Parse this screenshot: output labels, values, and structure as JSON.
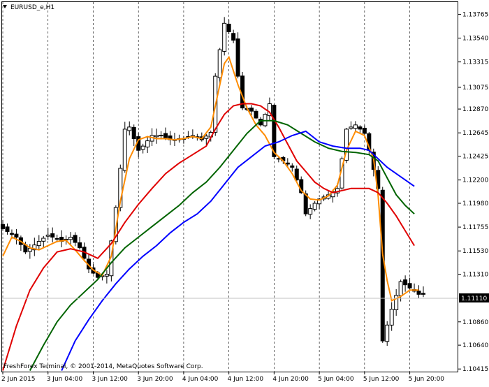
{
  "symbol_label": "EURUSD_e,H1",
  "copyright": "FreshForex Terminal, © 2001-2014, MetaQuotes Software Corp.",
  "current_price": "1.11110",
  "colors": {
    "background": "#ffffff",
    "grid": "#000000",
    "candle": "#000000",
    "ma_orange": "#ff8c00",
    "ma_red": "#e00000",
    "ma_green": "#006400",
    "ma_blue": "#0000ff",
    "price_marker_bg": "#000000",
    "price_marker_fg": "#ffffff"
  },
  "chart_data": {
    "type": "candlestick",
    "yaxis_ticks": [
      "1.13765",
      "1.13540",
      "1.13315",
      "1.13075",
      "1.12870",
      "1.12645",
      "1.12425",
      "1.12200",
      "1.11980",
      "1.11755",
      "1.11530",
      "1.11310",
      "1.10860",
      "1.10640",
      "1.10415"
    ],
    "ytick_values": [
      1.13765,
      1.1354,
      1.13315,
      1.13075,
      1.1287,
      1.12645,
      1.12425,
      1.122,
      1.1198,
      1.11755,
      1.1153,
      1.1131,
      1.1086,
      1.1064,
      1.10415
    ],
    "yrange": [
      1.1039,
      1.1388
    ],
    "xaxis_ticks": [
      "2 Jun 2015",
      "3 Jun 04:00",
      "3 Jun 12:00",
      "3 Jun 20:00",
      "4 Jun 04:00",
      "4 Jun 12:00",
      "4 Jun 20:00",
      "5 Jun 04:00",
      "5 Jun 12:00",
      "5 Jun 20:00"
    ],
    "xtick_index": [
      0,
      10,
      20,
      30,
      40,
      50,
      60,
      70,
      80,
      90
    ],
    "bar_count": 94,
    "current_price_value": 1.1111,
    "close_path": [
      [
        0,
        1.1174
      ],
      [
        3,
        1.1166
      ],
      [
        5,
        1.1152
      ],
      [
        8,
        1.1162
      ],
      [
        10,
        1.1168
      ],
      [
        13,
        1.1162
      ],
      [
        15,
        1.1166
      ],
      [
        17,
        1.1156
      ],
      [
        19,
        1.1136
      ],
      [
        21,
        1.1128
      ],
      [
        23,
        1.1131
      ],
      [
        25,
        1.1194
      ],
      [
        27,
        1.1268
      ],
      [
        28,
        1.127
      ],
      [
        30,
        1.1248
      ],
      [
        31,
        1.1252
      ],
      [
        33,
        1.1262
      ],
      [
        35,
        1.1262
      ],
      [
        37,
        1.1258
      ],
      [
        39,
        1.1258
      ],
      [
        42,
        1.1262
      ],
      [
        44,
        1.1258
      ],
      [
        46,
        1.1265
      ],
      [
        47,
        1.1318
      ],
      [
        49,
        1.1368
      ],
      [
        51,
        1.1352
      ],
      [
        52,
        1.1318
      ],
      [
        53,
        1.1288
      ],
      [
        55,
        1.1285
      ],
      [
        57,
        1.1272
      ],
      [
        59,
        1.1292
      ],
      [
        60,
        1.1242
      ],
      [
        62,
        1.1238
      ],
      [
        64,
        1.1232
      ],
      [
        66,
        1.1208
      ],
      [
        67,
        1.1188
      ],
      [
        69,
        1.1198
      ],
      [
        70,
        1.1202
      ],
      [
        72,
        1.1206
      ],
      [
        74,
        1.1212
      ],
      [
        76,
        1.1268
      ],
      [
        78,
        1.1272
      ],
      [
        80,
        1.1264
      ],
      [
        81,
        1.1248
      ],
      [
        83,
        1.1212
      ],
      [
        84,
        1.1068
      ],
      [
        86,
        1.1098
      ],
      [
        88,
        1.1124
      ],
      [
        90,
        1.1118
      ],
      [
        92,
        1.1112
      ]
    ],
    "series": [
      {
        "color": "#ff8c00",
        "points": [
          [
            0,
            1.1148
          ],
          [
            2,
            1.1166
          ],
          [
            4,
            1.1162
          ],
          [
            6,
            1.1156
          ],
          [
            8,
            1.1154
          ],
          [
            10,
            1.1158
          ],
          [
            12,
            1.1162
          ],
          [
            14,
            1.1163
          ],
          [
            16,
            1.1154
          ],
          [
            18,
            1.1144
          ],
          [
            20,
            1.1135
          ],
          [
            22,
            1.113
          ],
          [
            24,
            1.1148
          ],
          [
            26,
            1.12
          ],
          [
            28,
            1.124
          ],
          [
            30,
            1.1258
          ],
          [
            32,
            1.1261
          ],
          [
            34,
            1.1259
          ],
          [
            36,
            1.1259
          ],
          [
            38,
            1.1258
          ],
          [
            40,
            1.1259
          ],
          [
            42,
            1.1261
          ],
          [
            44,
            1.1259
          ],
          [
            46,
            1.127
          ],
          [
            48,
            1.131
          ],
          [
            49,
            1.133
          ],
          [
            50,
            1.1336
          ],
          [
            52,
            1.131
          ],
          [
            54,
            1.1288
          ],
          [
            56,
            1.1272
          ],
          [
            58,
            1.1262
          ],
          [
            60,
            1.1246
          ],
          [
            62,
            1.1238
          ],
          [
            64,
            1.1226
          ],
          [
            66,
            1.121
          ],
          [
            68,
            1.1202
          ],
          [
            70,
            1.1201
          ],
          [
            72,
            1.1205
          ],
          [
            74,
            1.1215
          ],
          [
            76,
            1.1248
          ],
          [
            78,
            1.1266
          ],
          [
            80,
            1.1262
          ],
          [
            82,
            1.124
          ],
          [
            83,
            1.1205
          ],
          [
            84,
            1.115
          ],
          [
            85,
            1.1125
          ],
          [
            86,
            1.1106
          ],
          [
            88,
            1.111
          ],
          [
            90,
            1.1116
          ],
          [
            92,
            1.1116
          ]
        ]
      },
      {
        "color": "#e00000",
        "points": [
          [
            0,
            1.104
          ],
          [
            3,
            1.1082
          ],
          [
            6,
            1.1116
          ],
          [
            9,
            1.1137
          ],
          [
            12,
            1.1152
          ],
          [
            15,
            1.1155
          ],
          [
            18,
            1.1152
          ],
          [
            21,
            1.1146
          ],
          [
            24,
            1.116
          ],
          [
            27,
            1.118
          ],
          [
            30,
            1.1197
          ],
          [
            33,
            1.1212
          ],
          [
            36,
            1.1226
          ],
          [
            39,
            1.1236
          ],
          [
            42,
            1.1244
          ],
          [
            45,
            1.1252
          ],
          [
            47,
            1.1268
          ],
          [
            49,
            1.1282
          ],
          [
            51,
            1.129
          ],
          [
            53,
            1.1292
          ],
          [
            55,
            1.1292
          ],
          [
            57,
            1.129
          ],
          [
            59,
            1.1284
          ],
          [
            61,
            1.127
          ],
          [
            63,
            1.1254
          ],
          [
            65,
            1.1238
          ],
          [
            67,
            1.1228
          ],
          [
            69,
            1.1218
          ],
          [
            71,
            1.1212
          ],
          [
            73,
            1.1208
          ],
          [
            75,
            1.121
          ],
          [
            77,
            1.1212
          ],
          [
            79,
            1.1212
          ],
          [
            81,
            1.1212
          ],
          [
            83,
            1.1208
          ],
          [
            85,
            1.1198
          ],
          [
            87,
            1.1186
          ],
          [
            89,
            1.1172
          ],
          [
            91,
            1.1158
          ]
        ]
      },
      {
        "color": "#006400",
        "points": [
          [
            6,
            1.104
          ],
          [
            9,
            1.1064
          ],
          [
            12,
            1.1086
          ],
          [
            15,
            1.1102
          ],
          [
            18,
            1.1114
          ],
          [
            21,
            1.1126
          ],
          [
            24,
            1.1142
          ],
          [
            27,
            1.1156
          ],
          [
            30,
            1.1166
          ],
          [
            33,
            1.1176
          ],
          [
            36,
            1.1186
          ],
          [
            39,
            1.1196
          ],
          [
            42,
            1.1208
          ],
          [
            45,
            1.1218
          ],
          [
            48,
            1.1232
          ],
          [
            51,
            1.1248
          ],
          [
            54,
            1.1264
          ],
          [
            57,
            1.1276
          ],
          [
            60,
            1.1276
          ],
          [
            63,
            1.1272
          ],
          [
            66,
            1.1264
          ],
          [
            69,
            1.1256
          ],
          [
            72,
            1.125
          ],
          [
            75,
            1.1247
          ],
          [
            78,
            1.1246
          ],
          [
            81,
            1.1244
          ],
          [
            83,
            1.1238
          ],
          [
            85,
            1.1222
          ],
          [
            87,
            1.1206
          ],
          [
            89,
            1.1196
          ],
          [
            91,
            1.1188
          ]
        ]
      },
      {
        "color": "#0000ff",
        "points": [
          [
            13,
            1.104
          ],
          [
            16,
            1.1068
          ],
          [
            19,
            1.1088
          ],
          [
            22,
            1.1106
          ],
          [
            25,
            1.1122
          ],
          [
            28,
            1.1136
          ],
          [
            31,
            1.1148
          ],
          [
            34,
            1.1158
          ],
          [
            37,
            1.117
          ],
          [
            40,
            1.118
          ],
          [
            43,
            1.1188
          ],
          [
            46,
            1.12
          ],
          [
            49,
            1.1216
          ],
          [
            52,
            1.1232
          ],
          [
            55,
            1.1242
          ],
          [
            58,
            1.1252
          ],
          [
            61,
            1.1256
          ],
          [
            64,
            1.1262
          ],
          [
            67,
            1.1266
          ],
          [
            70,
            1.1256
          ],
          [
            73,
            1.1252
          ],
          [
            76,
            1.125
          ],
          [
            79,
            1.125
          ],
          [
            81,
            1.1248
          ],
          [
            83,
            1.124
          ],
          [
            85,
            1.1232
          ],
          [
            87,
            1.1226
          ],
          [
            89,
            1.122
          ],
          [
            91,
            1.1214
          ]
        ]
      }
    ]
  }
}
